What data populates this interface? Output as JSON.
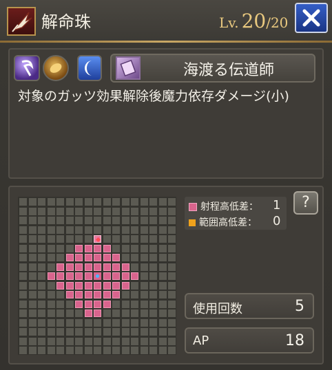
{
  "header": {
    "title": "解命珠",
    "level_label": "Lv.",
    "level_current": "20",
    "level_max": "/20",
    "icon": "feather-quill-icon",
    "close_icon": "close-x-icon"
  },
  "skill": {
    "badges": [
      "dark-magic-element-icon",
      "gold-orb-icon",
      "moon-icon"
    ],
    "job_icon": "scroll-book-icon",
    "job_name": "海渡る伝道師",
    "description": "対象のガッツ効果解除後魔力依存ダメージ(小)"
  },
  "legend": {
    "range_height_label": "射程高低差：",
    "range_height_value": "1",
    "area_height_label": "範囲高低差：",
    "area_height_value": "0",
    "range_color": "#d9648d",
    "area_color": "#f0a21c"
  },
  "help_label": "?",
  "stats": {
    "uses_label": "使用回数",
    "uses_value": "5",
    "ap_label": "AP",
    "ap_value": "18"
  },
  "colors": {
    "accent_gold": "#e9c97f",
    "range_pink": "#d9648d",
    "center_blue": "#4bb6ff",
    "origin_red": "#ff4b55",
    "close_blue": "#1a3585"
  },
  "range_grid": {
    "columns": 17,
    "rows": 17,
    "center": [
      8,
      8
    ],
    "origin": [
      4,
      8
    ],
    "rows_spec": [
      {
        "row": 4,
        "from": 8,
        "to": 8
      },
      {
        "row": 5,
        "from": 6,
        "to": 9
      },
      {
        "row": 6,
        "from": 5,
        "to": 10
      },
      {
        "row": 7,
        "from": 4,
        "to": 11
      },
      {
        "row": 8,
        "from": 3,
        "to": 12
      },
      {
        "row": 9,
        "from": 4,
        "to": 11
      },
      {
        "row": 10,
        "from": 5,
        "to": 10
      },
      {
        "row": 11,
        "from": 6,
        "to": 9
      },
      {
        "row": 12,
        "from": 7,
        "to": 8
      }
    ]
  }
}
